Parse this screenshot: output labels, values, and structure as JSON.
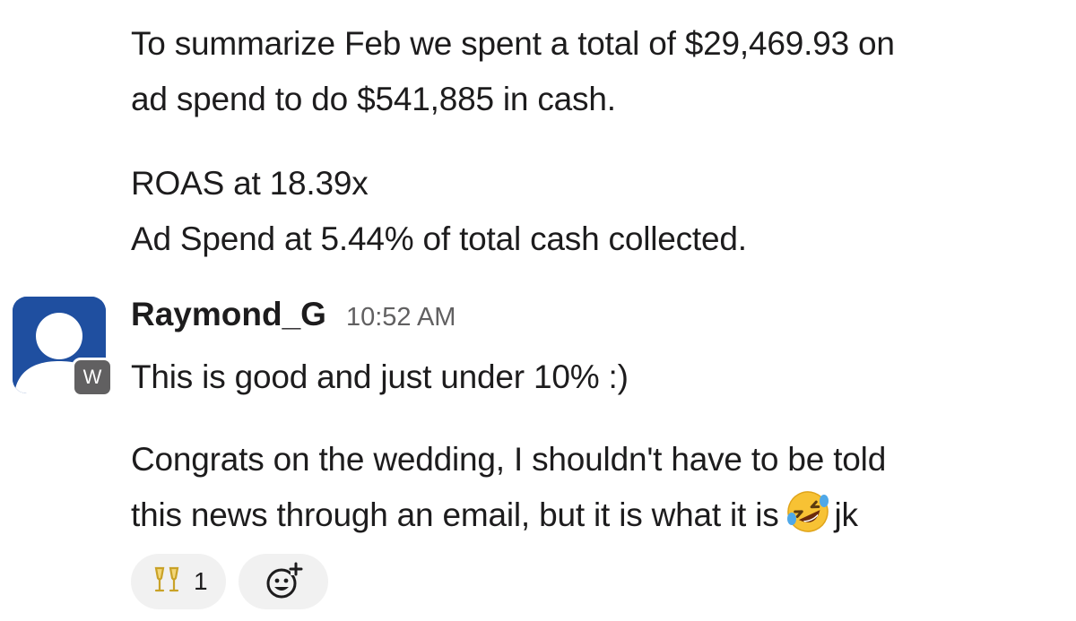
{
  "previous_message": {
    "lines": [
      "To summarize Feb we spent a total of $29,469.93 on",
      "ad spend to do $541,885 in cash."
    ],
    "stats": [
      "ROAS at 18.39x",
      "Ad Spend at 5.44% of total cash collected."
    ]
  },
  "message": {
    "author": "Raymond_G",
    "time": "10:52 AM",
    "workspace_badge": "W",
    "avatar_icon": "default-user-avatar",
    "first_line": "This is good and just under 10% :)",
    "second_paragraph_line1": "Congrats on the wedding, I shouldn't have to be told",
    "second_paragraph_line2_pre": "this news through an email, but it is what it is",
    "inline_emoji": "rolling-on-the-floor-laughing",
    "second_paragraph_line2_post": "jk"
  },
  "reactions": [
    {
      "emoji_name": "clinking-glasses",
      "emoji": "🥂",
      "count": "1"
    }
  ],
  "add_reaction_icon": "add-emoji-reaction-icon",
  "colors": {
    "avatar_bg": "#1f4fa0",
    "badge_bg": "#616061",
    "text": "#1d1c1d",
    "timestamp": "#616061",
    "pill_bg": "#f1f1f1"
  }
}
